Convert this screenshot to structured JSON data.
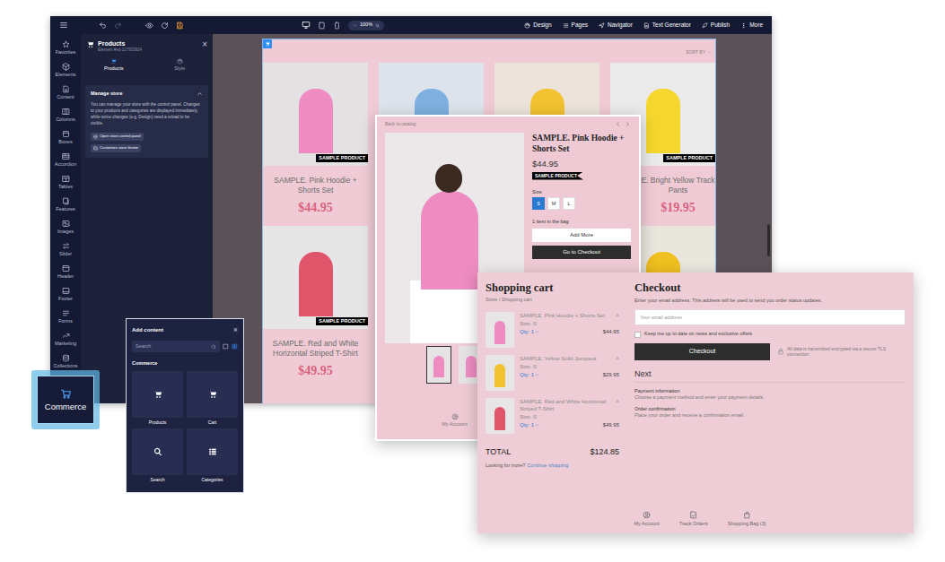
{
  "editor": {
    "toolbar": {
      "zoom": "100%",
      "items": [
        {
          "label": "Design"
        },
        {
          "label": "Pages"
        },
        {
          "label": "Navigator"
        },
        {
          "label": "Text Generator"
        },
        {
          "label": "Publish"
        },
        {
          "label": "More"
        }
      ]
    },
    "sidebar": {
      "items": [
        {
          "label": "Favorites"
        },
        {
          "label": "Elements"
        },
        {
          "label": "Content"
        },
        {
          "label": "Columns"
        },
        {
          "label": "Boxes"
        },
        {
          "label": "Accordion"
        },
        {
          "label": "Tables"
        },
        {
          "label": "Features"
        },
        {
          "label": "Images"
        },
        {
          "label": "Slider"
        },
        {
          "label": "Header"
        },
        {
          "label": "Footer"
        },
        {
          "label": "Forms"
        },
        {
          "label": "Marketing"
        },
        {
          "label": "Collections"
        }
      ]
    },
    "panel": {
      "title": "Products",
      "subtitle": "Element #ed-117953924",
      "close": "×",
      "tabs": [
        {
          "label": "Products",
          "selected": true
        },
        {
          "label": "Style",
          "selected": false
        }
      ],
      "section": {
        "title": "Manage store",
        "expanded": true,
        "text": "You can manage your store with the control panel. Changes to your products and categories are displayed immediately, while some changes (e.g. Design) need a reload to be visible.",
        "buttons": [
          {
            "label": "Open store control panel"
          },
          {
            "label": "Customize store theme"
          }
        ]
      }
    },
    "canvas": {
      "sort": "SORT BY",
      "cards": [
        {
          "title": "SAMPLE. Pink Hoodie + Shorts Set",
          "price": "$44.95",
          "badge": "SAMPLE PRODUCT"
        },
        {},
        {},
        {
          "title": "E. Bright Yellow Track Pants",
          "price": "$19.95",
          "badge": "SAMPLE PRODUCT"
        },
        {
          "title": "SAMPLE. Red and White Horizontal Striped T-Shirt",
          "price": "$49.95",
          "badge": "SAMPLE PRODUCT"
        },
        {},
        {},
        {}
      ]
    }
  },
  "commerce_callout": {
    "label": "Commerce"
  },
  "add_content": {
    "title": "Add content",
    "close": "×",
    "search": {
      "placeholder": "Search"
    },
    "views": [
      {
        "kind": "list",
        "selected": false
      },
      {
        "kind": "grid",
        "selected": true
      }
    ],
    "section": "Commerce",
    "tiles": [
      {
        "label": "Products"
      },
      {
        "label": "Cart"
      },
      {
        "label": "Search"
      },
      {
        "label": "Categories"
      }
    ]
  },
  "product_detail": {
    "back": "Back to catalog",
    "title": "SAMPLE. Pink Hoodie + Shorts Set",
    "price": "$44.95",
    "badge": "SAMPLE PRODUCT",
    "size_label": "Size",
    "sizes": [
      {
        "label": "S",
        "selected": true
      },
      {
        "label": "M",
        "selected": false
      },
      {
        "label": "L",
        "selected": false
      }
    ],
    "bag_note": "1 item in the bag",
    "buttons": [
      {
        "label": "Add More"
      },
      {
        "label": "Go to Checkout"
      }
    ],
    "thumbnails": [
      {
        "selected": true
      },
      {
        "selected": false
      }
    ],
    "account": "My Account"
  },
  "cart": {
    "title": "Shopping cart",
    "breadcrumb": "Store / Shopping cart",
    "items": [
      {
        "name": "SAMPLE. Pink Hoodie + Shorts Set",
        "size": "Size: S",
        "qty": "Qty: 1",
        "price": "$44.95",
        "remove": "×"
      },
      {
        "name": "SAMPLE. Yellow Solid Jumpsuit",
        "size": "Size: S",
        "qty": "Qty: 1",
        "price": "$29.95",
        "remove": "×"
      },
      {
        "name": "SAMPLE. Red and White Horizontal Striped T-Shirt",
        "size": "Size: S",
        "qty": "Qty: 1",
        "price": "$49.95",
        "remove": "×"
      }
    ],
    "total_label": "TOTAL",
    "total": "$124.85",
    "more": "Looking for more?",
    "more_link": "Continue shopping"
  },
  "checkout": {
    "title": "Checkout",
    "intro": "Enter your email address. This address will be used to send you order status updates.",
    "email": {
      "placeholder": "Your email address"
    },
    "newsletter": {
      "label": "Keep me up to date on news and exclusive offers",
      "checked": false
    },
    "button": "Checkout",
    "secure_note": "All data is transmitted encrypted via a secure TLS connection",
    "next": "Next",
    "steps": [
      {
        "title": "Payment information",
        "text": "Choose a payment method and enter your payment details."
      },
      {
        "title": "Order confirmation",
        "text": "Place your order and receive a confirmation email."
      }
    ]
  },
  "store_footer": {
    "items": [
      {
        "label": "My Account"
      },
      {
        "label": "Track Orders"
      },
      {
        "label": "Shopping Bag (3)"
      }
    ]
  }
}
